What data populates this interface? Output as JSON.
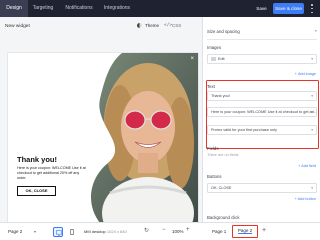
{
  "topbar": {
    "tabs": [
      {
        "label": "Design",
        "active": true
      },
      {
        "label": "Targeting",
        "active": false
      },
      {
        "label": "Notifications",
        "active": false
      },
      {
        "label": "Integrations",
        "active": false
      }
    ],
    "save_label": "Save",
    "save_close_label": "Save & close",
    "menu_icon": "vertical-dots-icon"
  },
  "canvas": {
    "widget_name": "New widget",
    "theme_label": "Theme",
    "css_label": "CSS",
    "popup": {
      "title": "Thank you!",
      "body": "Here is your coupon: WELCOME Use it at checkout to get additional 20% off any order.",
      "button_label": "OK, CLOSE",
      "close_glyph": "×"
    }
  },
  "bottombar": {
    "page_select": "Page 2",
    "device": "desktop",
    "size_label": "MM desktop",
    "size_detail": "1024 x 640",
    "zoom": "100%",
    "pages": [
      "Page 1",
      "Page 2"
    ],
    "active_page": "Page 2",
    "add_glyph": "+",
    "zoom_out_glyph": "−",
    "zoom_in_glyph": "+",
    "refresh_glyph": "↻"
  },
  "panel": {
    "size_spacing_label": "Size and spacing",
    "images_label": "Images",
    "image_field": "Edit",
    "add_image": "+ Add image",
    "text_label": "Text",
    "text_fields": [
      "Thank you!",
      "Here is your coupon: WELCOME Use it at checkout to get ad...",
      "Promo valid for your first purchase only"
    ],
    "fields_label": "Fields",
    "fields_helper": "There are no fields",
    "add_field": "+ Add field",
    "buttons_label": "Buttons",
    "button_field": "OK, CLOSE",
    "add_button": "+ Add button",
    "background_label": "Background click",
    "accent_color": "#3d7cf5",
    "highlight_color": "#e8342a"
  }
}
